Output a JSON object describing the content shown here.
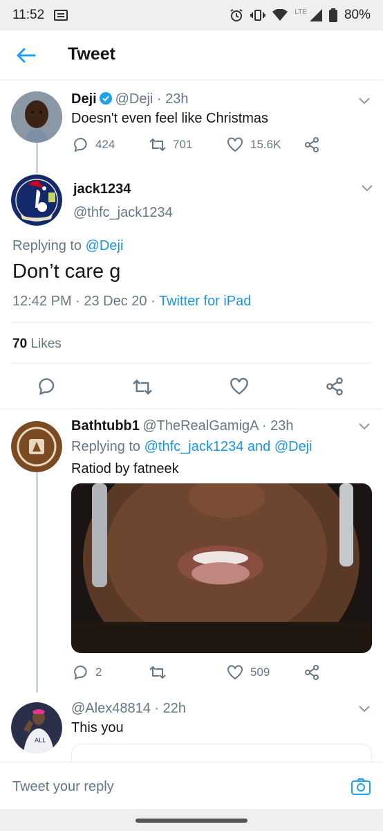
{
  "status": {
    "time": "11:52",
    "network": "LTE",
    "battery": "80%"
  },
  "header": {
    "title": "Tweet"
  },
  "tweet1": {
    "name": "Deji",
    "handle_time": "@Deji · 23h",
    "text": "Doesn't even feel like Christmas",
    "replies": "424",
    "retweets": "701",
    "likes": "15.6K"
  },
  "main": {
    "name": "jack1234",
    "handle": "@thfc_jack1234",
    "replying_prefix": "Replying to",
    "replying_handle": "@Deji",
    "text": "Don’t care g",
    "timestamp": "12:42 PM · 23 Dec 20 · ",
    "source": "Twitter for iPad",
    "likes_count": "70",
    "likes_label": "Likes"
  },
  "reply1": {
    "name": "Bathtubb1",
    "handle_time": "@TheRealGamigA · 23h",
    "replying_prefix": "Replying to",
    "replying_handles": "@thfc_jack1234 and @Deji",
    "text": "Ratiod by fatneek",
    "replies": "2",
    "likes": "509"
  },
  "reply2": {
    "name": "",
    "handle_time": "@Alex48814 · 22h",
    "text": "This you"
  },
  "compose": {
    "placeholder": "Tweet your reply"
  },
  "colors": {
    "accent": "#1da1f2",
    "link": "#1b95e0",
    "muted": "#657786",
    "verified": "#1da1f2"
  }
}
